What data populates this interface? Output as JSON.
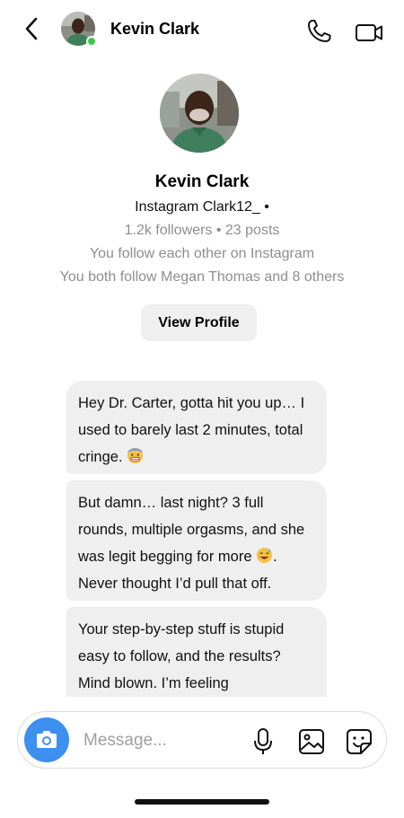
{
  "header": {
    "contact_name": "Kevin Clark",
    "online": true,
    "icons": {
      "back": "chevron-left-icon",
      "call": "phone-icon",
      "video": "video-camera-icon"
    }
  },
  "profile": {
    "name": "Kevin Clark",
    "handle": "Instagram   Clark12_  •",
    "stats": "1.2k followers • 23 posts",
    "mutual_follow": "You follow each other on  Instagram",
    "both_follow": "You both follow  Megan Thomas and  8 others",
    "view_profile_label": "View Profile"
  },
  "messages": [
    {
      "from": "contact",
      "text": "Hey Dr. Carter, gotta hit you up… I used to barely last 2 minutes, total cringe.",
      "emoji": "grimacing-face"
    },
    {
      "from": "contact",
      "text_before_emoji": "But damn… last night? 3 full rounds, multiple orgasms, and she was legit begging for more",
      "emoji": "smiling-face-with-sweat",
      "text_after_emoji": ". Never thought I’d pull that off."
    },
    {
      "from": "contact",
      "text": "Your step-by-step stuff is stupid easy to follow, and the results? Mind blown. I’m feeling"
    }
  ],
  "composer": {
    "placeholder": "Message...",
    "value": "",
    "icons": {
      "camera": "camera-icon",
      "mic": "microphone-icon",
      "gallery": "image-gallery-icon",
      "sticker": "sticker-icon"
    },
    "camera_color": "#3d8ff0"
  },
  "colors": {
    "bubble": "#efefef",
    "secondary_text": "#8e8e8e",
    "online": "#3cc84a"
  }
}
